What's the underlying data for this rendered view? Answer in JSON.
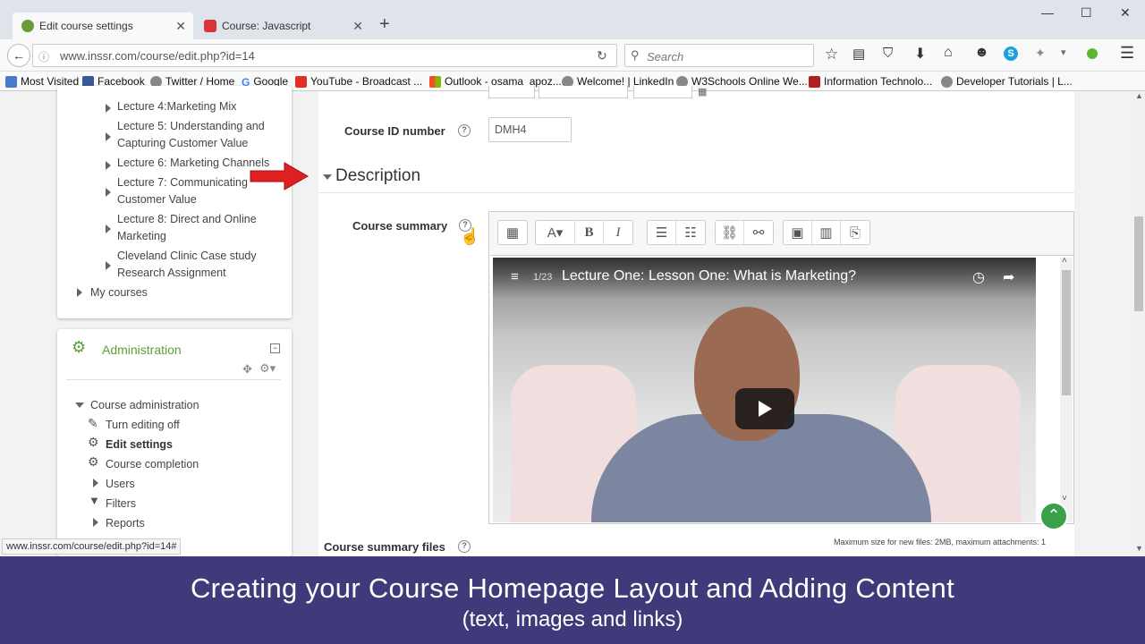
{
  "browser": {
    "tabs": [
      {
        "label": "Edit course settings"
      },
      {
        "label": "Course: Javascript"
      }
    ],
    "new_tab": "+",
    "url": "www.inssr.com/course/edit.php?id=14",
    "search_placeholder": "Search",
    "bookmarks": [
      {
        "label": "Most Visited"
      },
      {
        "label": "Facebook"
      },
      {
        "label": "Twitter / Home"
      },
      {
        "label": "Google"
      },
      {
        "label": "YouTube - Broadcast ..."
      },
      {
        "label": "Outlook - osama_apoz..."
      },
      {
        "label": "Welcome! | LinkedIn"
      },
      {
        "label": "W3Schools Online We..."
      },
      {
        "label": "Information Technolo..."
      },
      {
        "label": "Developer Tutorials | L..."
      }
    ],
    "status_url": "www.inssr.com/course/edit.php?id=14#"
  },
  "sidebar": {
    "lectures": [
      {
        "label": "Lecture 4:Marketing Mix"
      },
      {
        "label": "Lecture 5: Understanding and Capturing Customer Value"
      },
      {
        "label": "Lecture 6: Marketing Channels"
      },
      {
        "label": "Lecture 7: Communicating Customer Value"
      },
      {
        "label": "Lecture 8: Direct and Online Marketing"
      },
      {
        "label": "Cleveland Clinic Case study Research Assignment"
      }
    ],
    "my_courses": "My courses",
    "admin_title": "Administration",
    "course_admin": "Course administration",
    "admin_items": [
      {
        "label": "Turn editing off"
      },
      {
        "label": "Edit settings"
      },
      {
        "label": "Course completion"
      },
      {
        "label": "Users"
      },
      {
        "label": "Filters"
      },
      {
        "label": "Reports"
      }
    ]
  },
  "form": {
    "course_id_label": "Course ID number",
    "course_id_value": "DMH4",
    "description_header": "Description",
    "course_summary_label": "Course summary",
    "course_summary_files_label": "Course summary files",
    "max_size_note": "Maximum size for new files: 2MB, maximum attachments: 1",
    "video": {
      "counter": "1/23",
      "title": "Lecture One: Lesson One: What is Marketing?"
    }
  },
  "overlay": {
    "title": "Creating your Course Homepage Layout and Adding Content",
    "subtitle": "(text, images and links)"
  },
  "colors": {
    "footer_bg": "#3f3b7a",
    "admin_green": "#5aa036",
    "arrow_red": "#e02020"
  }
}
